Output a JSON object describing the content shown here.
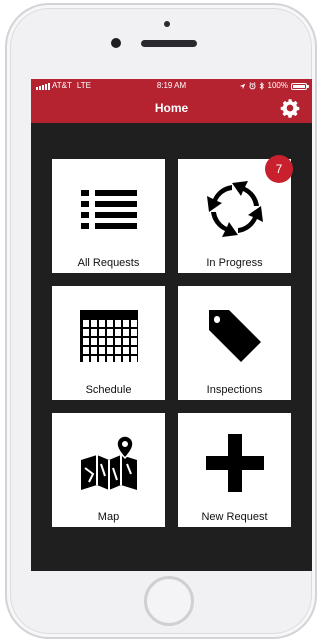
{
  "status_bar": {
    "carrier": "AT&T",
    "network": "LTE",
    "time": "8:19 AM",
    "battery": "100%",
    "battery_level": 1.0,
    "icons": [
      "location-icon",
      "alarm-icon",
      "bluetooth-icon"
    ]
  },
  "header": {
    "title": "Home",
    "settings_icon": "gear-icon"
  },
  "tiles": [
    {
      "label": "All Requests",
      "icon": "list-icon"
    },
    {
      "label": "In Progress",
      "icon": "refresh-arrows-icon",
      "badge": "7"
    },
    {
      "label": "Schedule",
      "icon": "calendar-icon"
    },
    {
      "label": "Inspections",
      "icon": "tag-icon"
    },
    {
      "label": "Map",
      "icon": "map-pin-icon"
    },
    {
      "label": "New Request",
      "icon": "plus-icon"
    }
  ],
  "colors": {
    "header": "#b52331",
    "badge": "#c8202d",
    "background": "#1f1f1f",
    "tile": "#ffffff"
  }
}
